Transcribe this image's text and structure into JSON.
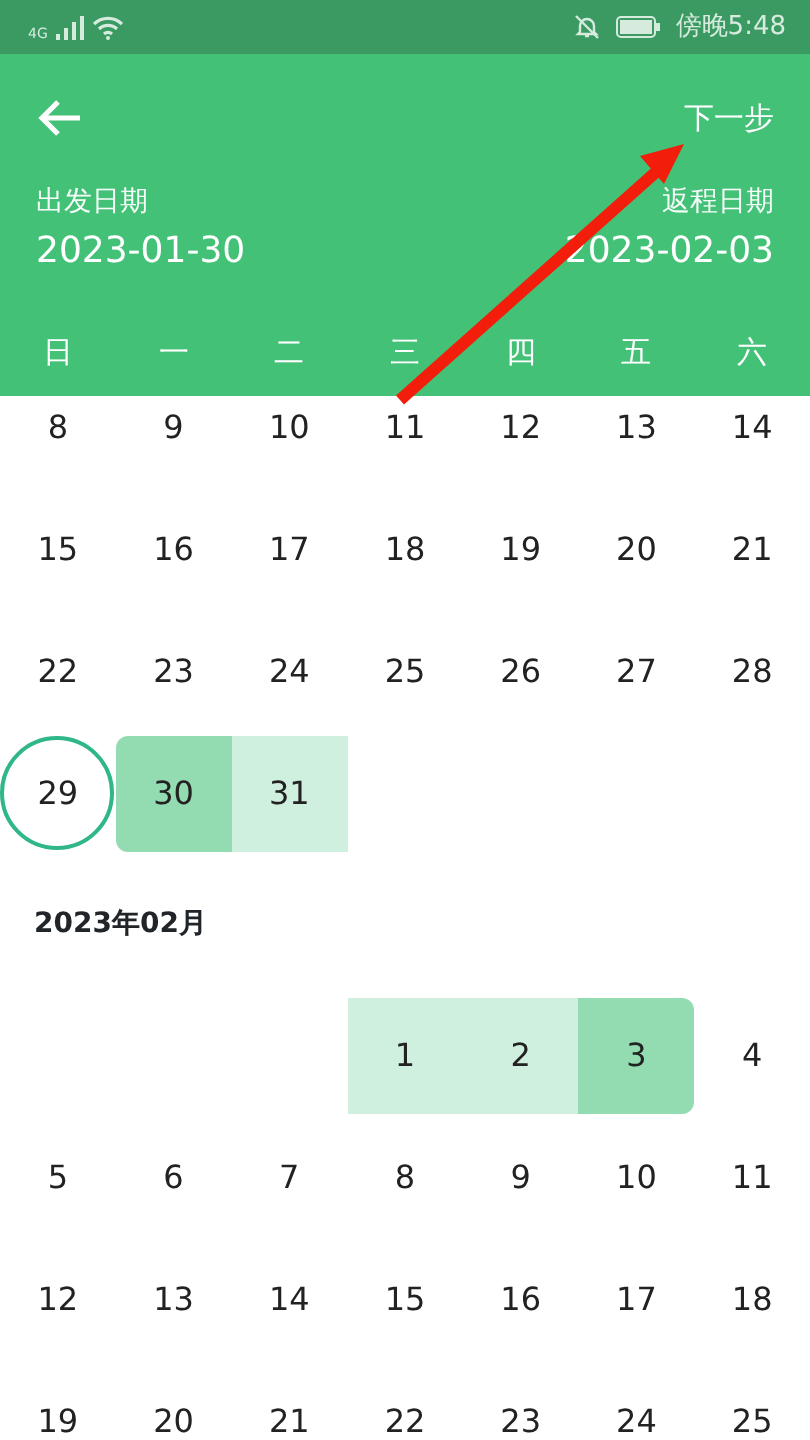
{
  "status_bar": {
    "network": "4G",
    "time": "傍晚5:48"
  },
  "header": {
    "next_label": "下一步",
    "depart_label": "出发日期",
    "depart_date": "2023-01-30",
    "return_label": "返程日期",
    "return_date": "2023-02-03"
  },
  "weekdays": [
    "日",
    "一",
    "二",
    "三",
    "四",
    "五",
    "六"
  ],
  "months": [
    {
      "weeks": [
        [
          {
            "day": "8",
            "kind": "plain"
          },
          {
            "day": "9",
            "kind": "plain"
          },
          {
            "day": "10",
            "kind": "plain"
          },
          {
            "day": "11",
            "kind": "plain"
          },
          {
            "day": "12",
            "kind": "plain"
          },
          {
            "day": "13",
            "kind": "plain"
          },
          {
            "day": "14",
            "kind": "plain"
          }
        ],
        [
          {
            "day": "15",
            "kind": "plain"
          },
          {
            "day": "16",
            "kind": "plain"
          },
          {
            "day": "17",
            "kind": "plain"
          },
          {
            "day": "18",
            "kind": "plain"
          },
          {
            "day": "19",
            "kind": "plain"
          },
          {
            "day": "20",
            "kind": "plain"
          },
          {
            "day": "21",
            "kind": "plain"
          }
        ],
        [
          {
            "day": "22",
            "kind": "plain"
          },
          {
            "day": "23",
            "kind": "plain"
          },
          {
            "day": "24",
            "kind": "plain"
          },
          {
            "day": "25",
            "kind": "plain"
          },
          {
            "day": "26",
            "kind": "plain"
          },
          {
            "day": "27",
            "kind": "plain"
          },
          {
            "day": "28",
            "kind": "plain"
          }
        ],
        [
          {
            "day": "29",
            "kind": "today"
          },
          {
            "day": "30",
            "kind": "start"
          },
          {
            "day": "31",
            "kind": "range"
          },
          {
            "kind": "blank"
          },
          {
            "kind": "blank"
          },
          {
            "kind": "blank"
          },
          {
            "kind": "blank"
          }
        ]
      ]
    },
    {
      "title": "2023年02月",
      "weeks": [
        [
          {
            "kind": "blank"
          },
          {
            "kind": "blank"
          },
          {
            "kind": "blank"
          },
          {
            "day": "1",
            "kind": "range"
          },
          {
            "day": "2",
            "kind": "range"
          },
          {
            "day": "3",
            "kind": "end"
          },
          {
            "day": "4",
            "kind": "plain"
          }
        ],
        [
          {
            "day": "5",
            "kind": "plain"
          },
          {
            "day": "6",
            "kind": "plain"
          },
          {
            "day": "7",
            "kind": "plain"
          },
          {
            "day": "8",
            "kind": "plain"
          },
          {
            "day": "9",
            "kind": "plain"
          },
          {
            "day": "10",
            "kind": "plain"
          },
          {
            "day": "11",
            "kind": "plain"
          }
        ],
        [
          {
            "day": "12",
            "kind": "plain"
          },
          {
            "day": "13",
            "kind": "plain"
          },
          {
            "day": "14",
            "kind": "plain"
          },
          {
            "day": "15",
            "kind": "plain"
          },
          {
            "day": "16",
            "kind": "plain"
          },
          {
            "day": "17",
            "kind": "plain"
          },
          {
            "day": "18",
            "kind": "plain"
          }
        ],
        [
          {
            "day": "19",
            "kind": "plain"
          },
          {
            "day": "20",
            "kind": "plain"
          },
          {
            "day": "21",
            "kind": "plain"
          },
          {
            "day": "22",
            "kind": "plain"
          },
          {
            "day": "23",
            "kind": "plain"
          },
          {
            "day": "24",
            "kind": "plain"
          },
          {
            "day": "25",
            "kind": "plain"
          }
        ]
      ]
    }
  ]
}
